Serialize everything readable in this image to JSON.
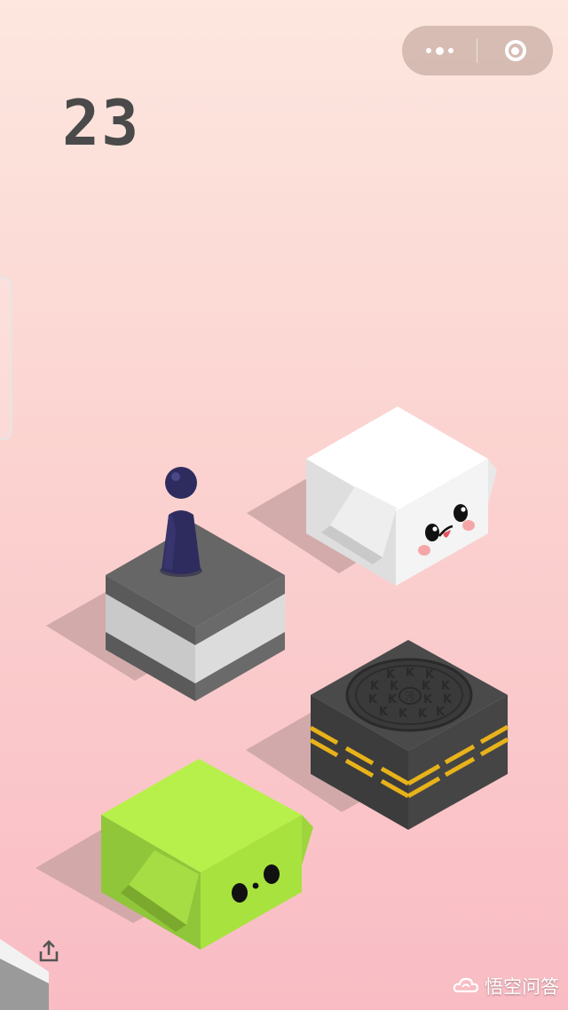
{
  "capsule": {
    "more_icon": "more-dots-icon",
    "close_icon": "target-circle-icon"
  },
  "score": "23",
  "game": {
    "player_color": "#2d2b5c",
    "blocks": [
      "gray-striped-cube",
      "white-face-cube",
      "manhole-cube",
      "green-face-cube",
      "partial-white-cube"
    ],
    "manhole_symbol": "污",
    "manhole_letter": "K"
  },
  "share_icon": "share-icon",
  "watermark": {
    "icon": "cloud-logo-icon",
    "text": "悟空问答"
  }
}
